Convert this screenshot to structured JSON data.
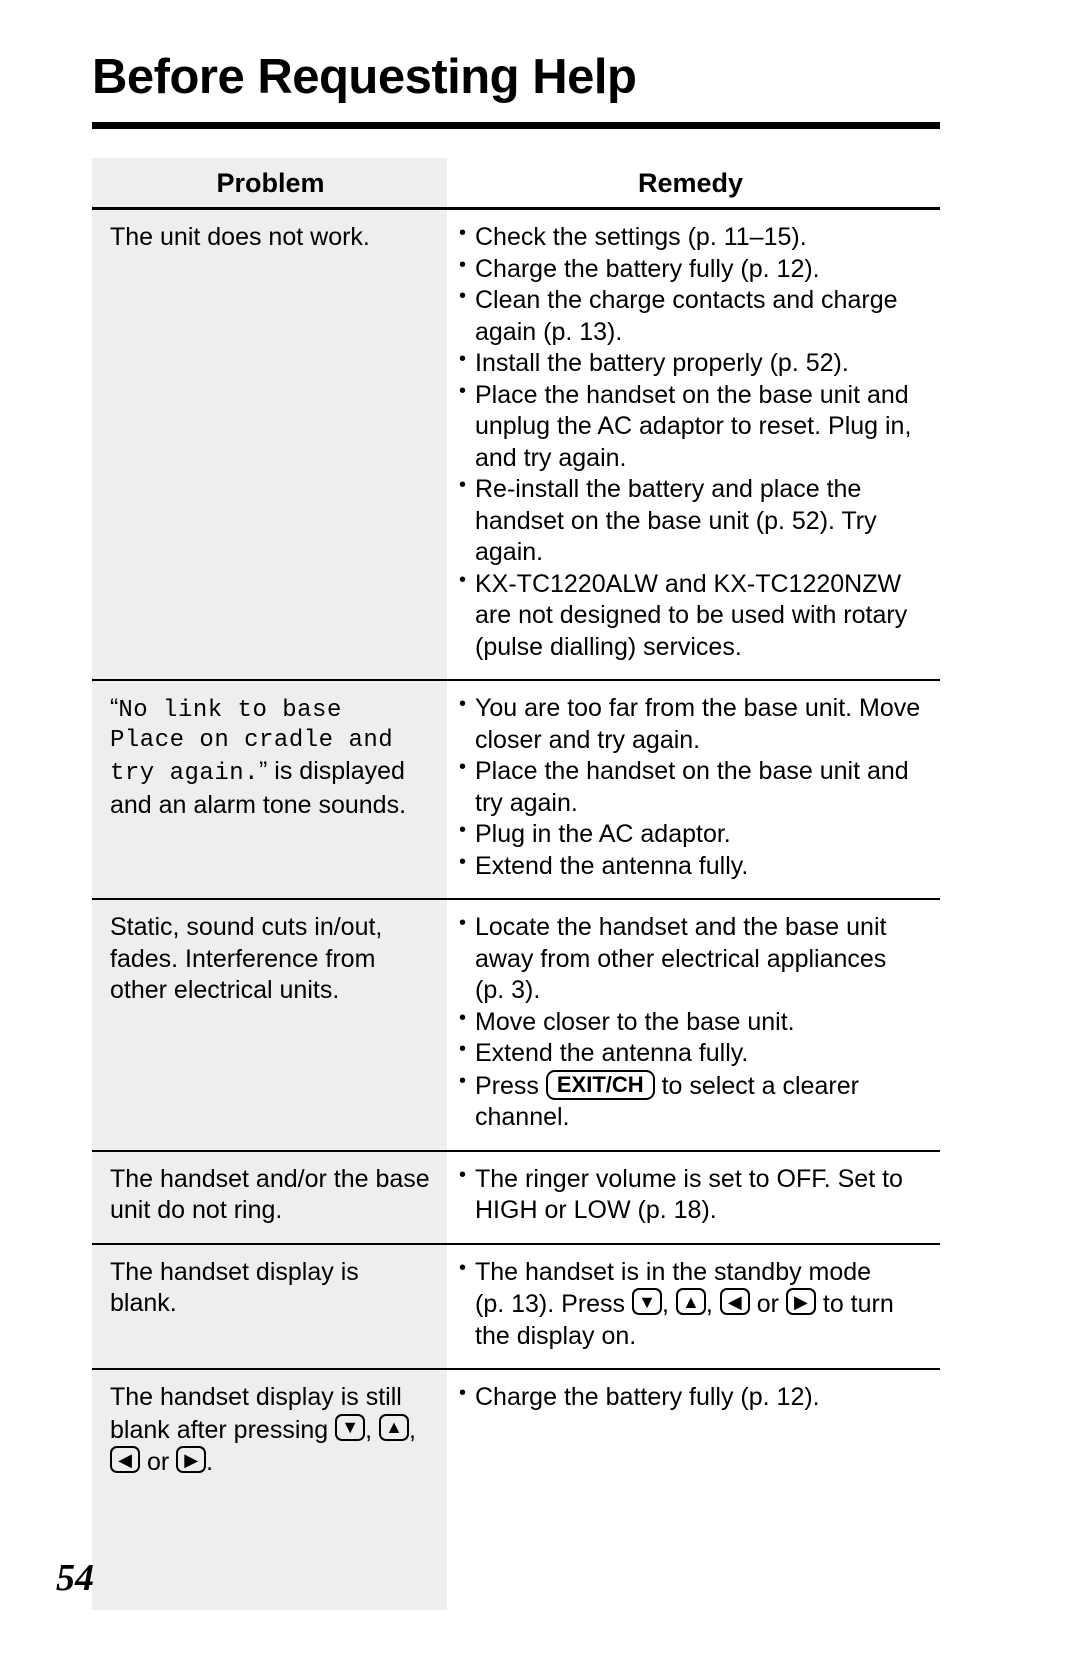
{
  "page": {
    "title": "Before Requesting Help",
    "page_number": "54"
  },
  "table": {
    "headers": {
      "problem": "Problem",
      "remedy": "Remedy"
    },
    "rows": [
      {
        "problem_lines": [
          "The unit does not work."
        ],
        "remedy_lines": [
          {
            "type": "bullet",
            "text": "Check the settings (p. 11–15)."
          },
          {
            "type": "bullet",
            "text": "Charge the battery fully (p. 12)."
          },
          {
            "type": "bullet",
            "text": "Clean the charge contacts and charge"
          },
          {
            "type": "cont",
            "text": "again (p. 13)."
          },
          {
            "type": "bullet",
            "text": "Install the battery properly (p. 52)."
          },
          {
            "type": "bullet",
            "text": "Place the handset on the base unit and"
          },
          {
            "type": "cont",
            "text": "unplug the AC adaptor to reset. Plug in,"
          },
          {
            "type": "cont",
            "text": "and try again."
          },
          {
            "type": "bullet",
            "text": "Re-install the battery and place the"
          },
          {
            "type": "cont",
            "text": "handset on the base unit (p. 52). Try"
          },
          {
            "type": "cont",
            "text": "again."
          },
          {
            "type": "bullet",
            "text": "KX-TC1220ALW and KX-TC1220NZW"
          },
          {
            "type": "cont",
            "text": "are not designed to be used with rotary"
          },
          {
            "type": "cont",
            "text": "(pulse dialling) services."
          }
        ]
      },
      {
        "problem_display_quote_open": "“",
        "problem_display_lines": [
          "No link to base",
          "Place on cradle and",
          "try again."
        ],
        "problem_display_quote_close": "”",
        "problem_trailing": " is displayed",
        "problem_last_line": "and an alarm tone sounds.",
        "remedy_lines": [
          {
            "type": "bullet",
            "text": "You are too far from the base unit. Move"
          },
          {
            "type": "cont",
            "text": "closer and try again."
          },
          {
            "type": "bullet",
            "text": "Place the handset on the base unit and"
          },
          {
            "type": "cont",
            "text": "try again."
          },
          {
            "type": "bullet",
            "text": "Plug in the AC adaptor."
          },
          {
            "type": "bullet",
            "text": "Extend the antenna fully."
          }
        ]
      },
      {
        "problem_lines": [
          "Static, sound cuts in/out,",
          "fades. Interference from",
          "other electrical units."
        ],
        "remedy_lines": [
          {
            "type": "bullet",
            "text": "Locate the handset and the base unit"
          },
          {
            "type": "cont",
            "text": "away from other electrical appliances"
          },
          {
            "type": "cont",
            "text": "(p. 3)."
          },
          {
            "type": "bullet",
            "text": "Move closer to the base unit."
          },
          {
            "type": "bullet",
            "text": "Extend the antenna fully."
          },
          {
            "type": "bullet-key",
            "pre": "Press ",
            "key": "EXIT/CH",
            "post": " to select a clearer"
          },
          {
            "type": "cont",
            "text": "channel."
          }
        ]
      },
      {
        "problem_lines": [
          "The handset and/or the base",
          "unit do not ring."
        ],
        "remedy_lines": [
          {
            "type": "bullet",
            "text": "The ringer volume is set to OFF. Set to"
          },
          {
            "type": "cont",
            "text": "HIGH or LOW (p. 18)."
          }
        ]
      },
      {
        "problem_lines": [
          "The handset display is",
          "blank."
        ],
        "remedy_lines": [
          {
            "type": "bullet",
            "text": "The handset is in the standby mode"
          },
          {
            "type": "cont-arrows",
            "pre": "(p. 13). Press ",
            "mid1": ", ",
            "mid2": ", ",
            "mid3": " or ",
            "post": " to turn",
            "arrows": [
              "▼",
              "▲",
              "◀",
              "▶"
            ]
          },
          {
            "type": "cont",
            "text": "the display on."
          }
        ]
      },
      {
        "problem_lines_arrows": {
          "line1": "The handset display is still",
          "line2_pre": "blank after pressing ",
          "line2_arrows": [
            "▼",
            "▲"
          ],
          "line2_sep": ", ",
          "line2_post": ",",
          "line3_arrows": [
            "◀",
            "▶"
          ],
          "line3_mid": " or ",
          "line3_post": "."
        },
        "remedy_lines": [
          {
            "type": "bullet",
            "text": "Charge the battery fully (p. 12)."
          }
        ]
      }
    ],
    "arrow_icons": {
      "down": "arrow-down-key-icon",
      "up": "arrow-up-key-icon",
      "left": "arrow-left-key-icon",
      "right": "arrow-right-key-icon",
      "exit_ch": "exit-ch-key-icon"
    }
  },
  "colors": {
    "problem_column_bg": "#eeeeee",
    "text": "#000000",
    "rule": "#000000"
  }
}
